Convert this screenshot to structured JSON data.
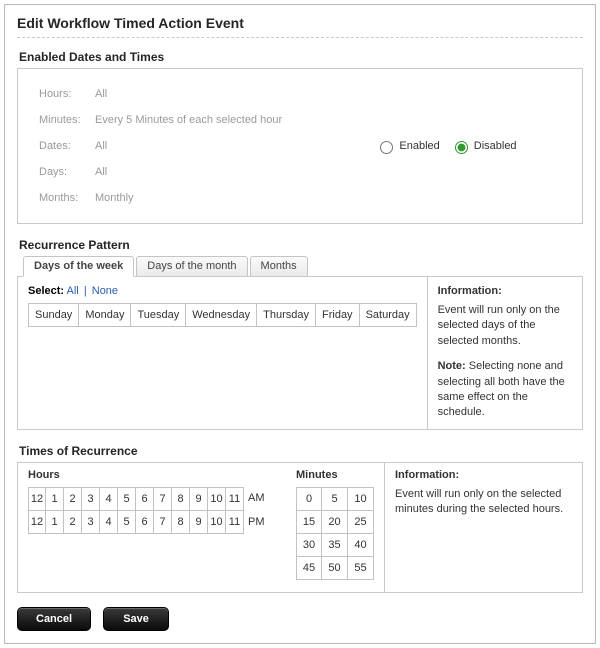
{
  "dialog": {
    "title": "Edit Workflow Timed Action Event"
  },
  "enabled_section": {
    "title": "Enabled Dates and Times",
    "rows": {
      "hours": {
        "label": "Hours:",
        "value": "All"
      },
      "minutes": {
        "label": "Minutes:",
        "value": "Every 5 Minutes of each selected hour"
      },
      "dates": {
        "label": "Dates:",
        "value": "All"
      },
      "days": {
        "label": "Days:",
        "value": "All"
      },
      "months": {
        "label": "Months:",
        "value": "Monthly"
      }
    },
    "radio": {
      "enabled_label": "Enabled",
      "disabled_label": "Disabled",
      "selected": "disabled"
    }
  },
  "recurrence": {
    "title": "Recurrence Pattern",
    "tabs": {
      "days_of_week": "Days of the week",
      "days_of_month": "Days of the month",
      "months": "Months"
    },
    "select_line": {
      "prefix": "Select:",
      "all": "All",
      "none": "None"
    },
    "days": [
      "Sunday",
      "Monday",
      "Tuesday",
      "Wednesday",
      "Thursday",
      "Friday",
      "Saturday"
    ],
    "info": {
      "title": "Information:",
      "body": "Event will run only on the selected days of the selected months.",
      "note_label": "Note:",
      "note_body": "Selecting none and selecting all both have the same effect on the schedule."
    }
  },
  "times": {
    "title": "Times of Recurrence",
    "hours_label": "Hours",
    "minutes_label": "Minutes",
    "ampm": {
      "am": "AM",
      "pm": "PM"
    },
    "hour_cells": [
      "12",
      "1",
      "2",
      "3",
      "4",
      "5",
      "6",
      "7",
      "8",
      "9",
      "10",
      "11"
    ],
    "minute_cells": [
      "0",
      "5",
      "10",
      "15",
      "20",
      "25",
      "30",
      "35",
      "40",
      "45",
      "50",
      "55"
    ],
    "info": {
      "title": "Information:",
      "body": "Event will run only on the selected minutes during the selected hours."
    }
  },
  "buttons": {
    "cancel": "Cancel",
    "save": "Save"
  }
}
